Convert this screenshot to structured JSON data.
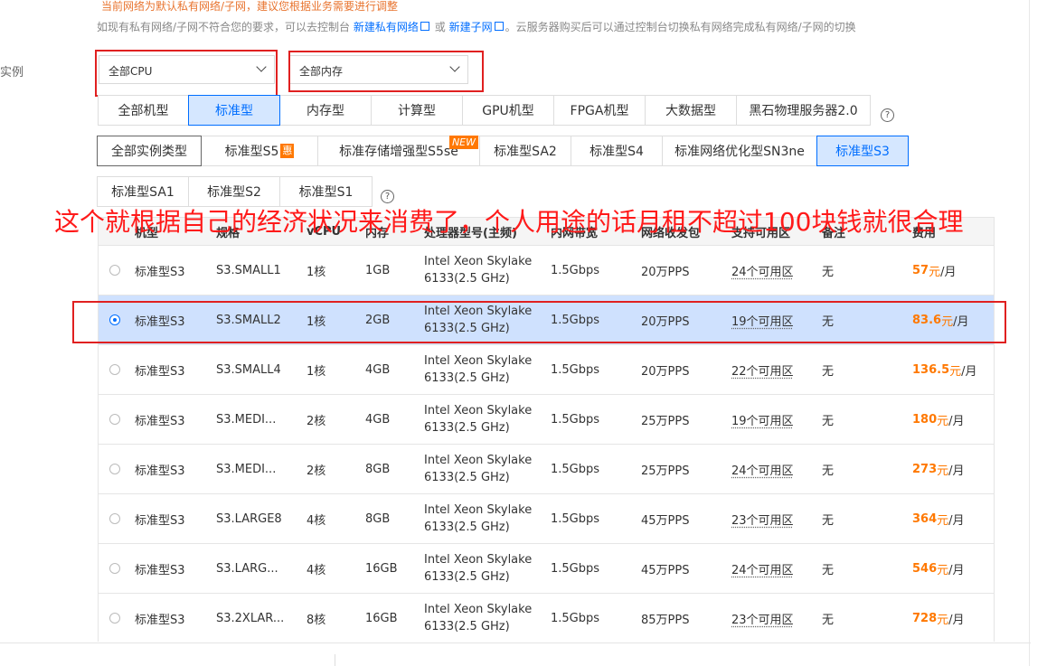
{
  "notice": "当前网络为默认私有网络/子网，建议您根据业务需要进行调整",
  "network_info": {
    "prefix": "如现有私有网络/子网不符合您的要求，可以去控制台",
    "link_vpc": "新建私有网络",
    "middle": "或",
    "link_subnet": "新建子网",
    "suffix": "。云服务器购买后可以通过控制台切换私有网络完成私有网络/子网的切换"
  },
  "instance_label": "实例",
  "filters": {
    "cpu": "全部CPU",
    "memory": "全部内存"
  },
  "family_tabs": [
    "全部机型",
    "标准型",
    "内存型",
    "计算型",
    "GPU机型",
    "FPGA机型",
    "大数据型",
    "黑石物理服务器2.0"
  ],
  "family_active": "标准型",
  "type_tabs": [
    "全部实例类型",
    "标准型S5",
    "标准存储增强型S5se",
    "标准型SA2",
    "标准型S4",
    "标准网络优化型SN3ne",
    "标准型S3",
    "标准型SA1",
    "标准型S2",
    "标准型S1"
  ],
  "type_active": "标准型S3",
  "badges": {
    "hui": "惠",
    "new": "NEW"
  },
  "help_glyph": "?",
  "overlay_text": "这个就根据自己的经济状况来消费了，个人用途的话月租不超过100块钱就很合理",
  "table": {
    "headers": [
      "机型",
      "规格",
      "vCPU",
      "内存",
      "处理器型号(主频)",
      "内网带宽",
      "网络收发包",
      "支持可用区",
      "备注",
      "费用"
    ],
    "rows": [
      {
        "model": "标准型S3",
        "spec": "S3.SMALL1",
        "vcpu": "1核",
        "mem": "1GB",
        "cpu1": "Intel Xeon Skylake",
        "cpu2": "6133(2.5 GHz)",
        "bw": "1.5Gbps",
        "pps": "20万PPS",
        "zones": "24个可用区",
        "note": "无",
        "price": "57",
        "unit": "元/月",
        "selected": false
      },
      {
        "model": "标准型S3",
        "spec": "S3.SMALL2",
        "vcpu": "1核",
        "mem": "2GB",
        "cpu1": "Intel Xeon Skylake",
        "cpu2": "6133(2.5 GHz)",
        "bw": "1.5Gbps",
        "pps": "20万PPS",
        "zones": "19个可用区",
        "note": "无",
        "price": "83.6",
        "unit": "元/月",
        "selected": true
      },
      {
        "model": "标准型S3",
        "spec": "S3.SMALL4",
        "vcpu": "1核",
        "mem": "4GB",
        "cpu1": "Intel Xeon Skylake",
        "cpu2": "6133(2.5 GHz)",
        "bw": "1.5Gbps",
        "pps": "20万PPS",
        "zones": "22个可用区",
        "note": "无",
        "price": "136.5",
        "unit": "元/月",
        "selected": false
      },
      {
        "model": "标准型S3",
        "spec": "S3.MEDI...",
        "vcpu": "2核",
        "mem": "4GB",
        "cpu1": "Intel Xeon Skylake",
        "cpu2": "6133(2.5 GHz)",
        "bw": "1.5Gbps",
        "pps": "25万PPS",
        "zones": "19个可用区",
        "note": "无",
        "price": "180",
        "unit": "元/月",
        "selected": false
      },
      {
        "model": "标准型S3",
        "spec": "S3.MEDI...",
        "vcpu": "2核",
        "mem": "8GB",
        "cpu1": "Intel Xeon Skylake",
        "cpu2": "6133(2.5 GHz)",
        "bw": "1.5Gbps",
        "pps": "25万PPS",
        "zones": "24个可用区",
        "note": "无",
        "price": "273",
        "unit": "元/月",
        "selected": false
      },
      {
        "model": "标准型S3",
        "spec": "S3.LARGE8",
        "vcpu": "4核",
        "mem": "8GB",
        "cpu1": "Intel Xeon Skylake",
        "cpu2": "6133(2.5 GHz)",
        "bw": "1.5Gbps",
        "pps": "45万PPS",
        "zones": "23个可用区",
        "note": "无",
        "price": "364",
        "unit": "元/月",
        "selected": false
      },
      {
        "model": "标准型S3",
        "spec": "S3.LARG...",
        "vcpu": "4核",
        "mem": "16GB",
        "cpu1": "Intel Xeon Skylake",
        "cpu2": "6133(2.5 GHz)",
        "bw": "1.5Gbps",
        "pps": "45万PPS",
        "zones": "24个可用区",
        "note": "无",
        "price": "546",
        "unit": "元/月",
        "selected": false
      },
      {
        "model": "标准型S3",
        "spec": "S3.2XLAR...",
        "vcpu": "8核",
        "mem": "16GB",
        "cpu1": "Intel Xeon Skylake",
        "cpu2": "6133(2.5 GHz)",
        "bw": "1.5Gbps",
        "pps": "85万PPS",
        "zones": "23个可用区",
        "note": "无",
        "price": "728",
        "unit": "元/月",
        "selected": false
      }
    ]
  },
  "colors": {
    "accent": "#006eff",
    "price": "#ff7800",
    "annotation": "#e02020",
    "selected_row": "#cfe1fe"
  }
}
